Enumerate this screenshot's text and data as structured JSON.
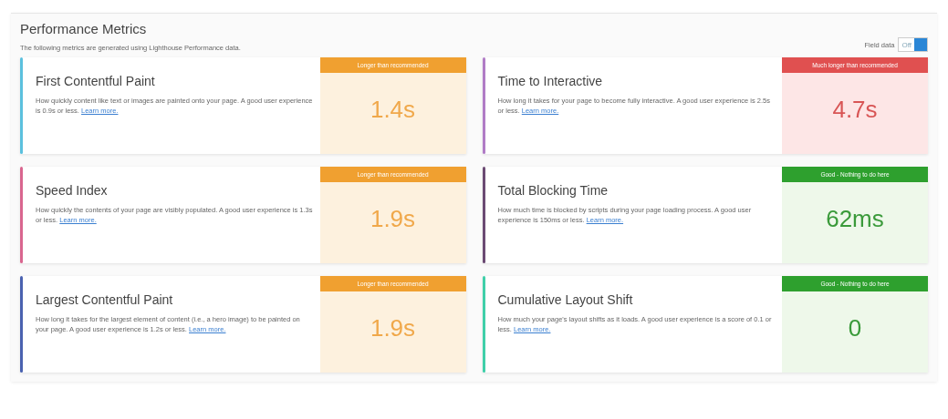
{
  "panel": {
    "title": "Performance Metrics",
    "subtitle": "The following metrics are generated using Lighthouse Performance data.",
    "toggle": {
      "label": "Field data",
      "state_text": "Off",
      "on": true
    }
  },
  "metrics": [
    {
      "name": "First Contentful Paint",
      "description": "How quickly content like text or images are painted onto your page. A good user experience is 0.9s or less.",
      "link": "Learn more.",
      "kind": "warn",
      "badge": "Longer than recommended",
      "value": "1.4s",
      "color": "#5bc0de"
    },
    {
      "name": "Time to Interactive",
      "description": "How long it takes for your page to become fully interactive. A good user experience is 2.5s or less.",
      "link": "Learn more.",
      "kind": "bad",
      "badge": "Much longer than recommended",
      "value": "4.7s",
      "color": "#b07cc6"
    },
    {
      "name": "Speed Index",
      "description": "How quickly the contents of your page are visibly populated. A good user experience is 1.3s or less.",
      "link": "Learn more.",
      "kind": "warn",
      "badge": "Longer than recommended",
      "value": "1.9s",
      "color": "#d9668f"
    },
    {
      "name": "Total Blocking Time",
      "description": "How much time is blocked by scripts during your page loading process. A good user experience is 150ms or less.",
      "link": "Learn more.",
      "kind": "good",
      "badge": "Good - Nothing to do here",
      "value": "62ms",
      "color": "#6b4a73"
    },
    {
      "name": "Largest Contentful Paint",
      "description": "How long it takes for the largest element of content (i.e., a hero image) to be painted on your page. A good user experience is 1.2s or less.",
      "link": "Learn more.",
      "kind": "warn",
      "badge": "Longer than recommended",
      "value": "1.9s",
      "color": "#4a62b0"
    },
    {
      "name": "Cumulative Layout Shift",
      "description": "How much your page's layout shifts as it loads. A good user experience is a score of 0.1 or less.",
      "link": "Learn more.",
      "kind": "good",
      "badge": "Good - Nothing to do here",
      "value": "0",
      "color": "#3fcfa9"
    }
  ]
}
